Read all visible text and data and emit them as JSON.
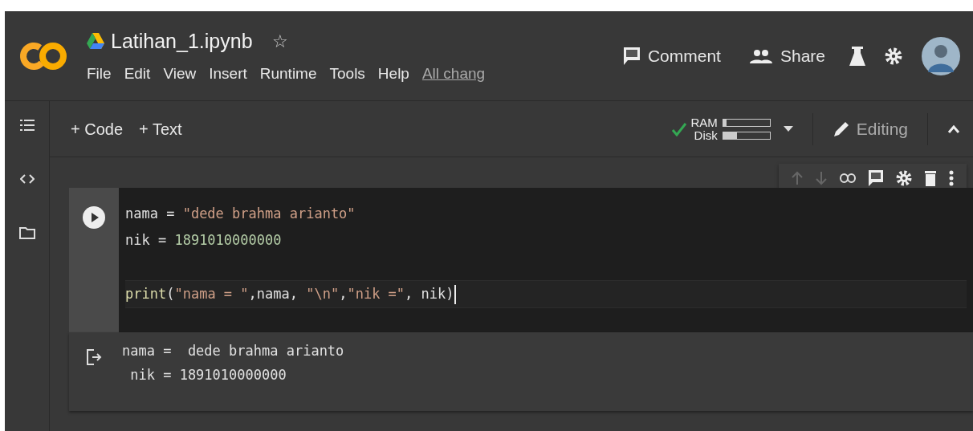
{
  "header": {
    "title": "Latihan_1.ipynb",
    "star": "☆",
    "menu": [
      "File",
      "Edit",
      "View",
      "Insert",
      "Runtime",
      "Tools",
      "Help"
    ],
    "save_status": "All chang",
    "actions": [
      {
        "kind": "comment",
        "label": "Comment"
      },
      {
        "kind": "share",
        "label": "Share"
      }
    ]
  },
  "toolbar": {
    "add_buttons": [
      "+ Code",
      "+ Text"
    ],
    "resources": [
      {
        "label": "RAM",
        "level": 0.08
      },
      {
        "label": "Disk",
        "level": 0.3
      }
    ],
    "mode": "Editing"
  },
  "cell": {
    "code_lines": [
      {
        "kind": "code",
        "tokens": [
          {
            "kind": "plain",
            "text": "nama = "
          },
          {
            "kind": "string",
            "text": "\"dede brahma arianto\""
          }
        ]
      },
      {
        "kind": "code",
        "tokens": [
          {
            "kind": "plain",
            "text": "nik = "
          },
          {
            "kind": "number",
            "text": "1891010000000"
          }
        ]
      },
      {
        "kind": "blank"
      },
      {
        "kind": "code",
        "tokens": [
          {
            "kind": "func",
            "text": "print"
          },
          {
            "kind": "plain",
            "text": "("
          },
          {
            "kind": "string",
            "text": "\"nama = \""
          },
          {
            "kind": "plain",
            "text": ",nama, "
          },
          {
            "kind": "string",
            "text": "\"\\n\""
          },
          {
            "kind": "plain",
            "text": ","
          },
          {
            "kind": "string",
            "text": "\"nik =\""
          },
          {
            "kind": "plain",
            "text": ", nik)"
          }
        ]
      }
    ],
    "output_lines": [
      "nama =  dede brahma arianto",
      " nik = 1891010000000"
    ]
  }
}
